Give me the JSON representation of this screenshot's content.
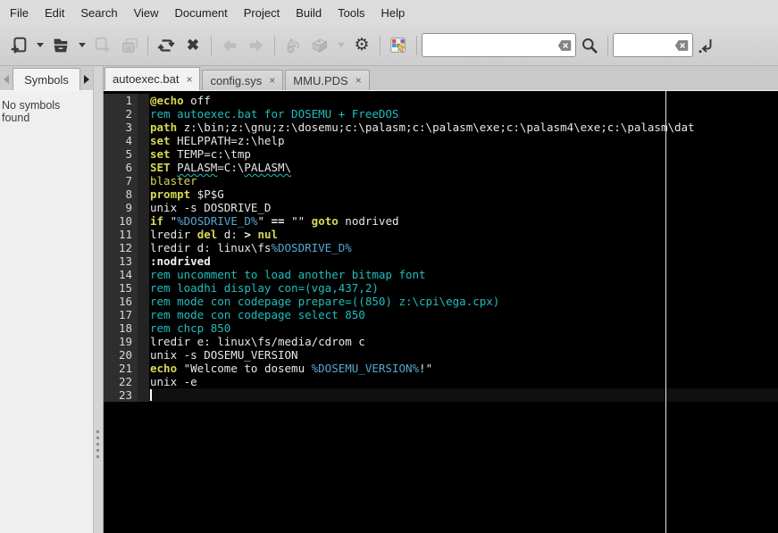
{
  "menubar": {
    "items": [
      "File",
      "Edit",
      "Search",
      "View",
      "Document",
      "Project",
      "Build",
      "Tools",
      "Help"
    ]
  },
  "toolbar": {
    "buttons": [
      {
        "name": "new",
        "icon": "new-file-icon",
        "enabled": true
      },
      {
        "name": "new-menu",
        "icon": "chevron-down-icon",
        "enabled": true
      },
      {
        "name": "open",
        "icon": "open-folder-icon",
        "enabled": true
      },
      {
        "name": "open-menu",
        "icon": "chevron-down-icon",
        "enabled": true
      },
      {
        "name": "save",
        "icon": "save-icon",
        "enabled": false
      },
      {
        "name": "save-all",
        "icon": "save-all-icon",
        "enabled": false
      },
      {
        "name": "revert",
        "icon": "reload-icon",
        "enabled": true
      },
      {
        "name": "close",
        "icon": "close-icon",
        "enabled": true
      },
      {
        "name": "back",
        "icon": "arrow-left-icon",
        "enabled": false
      },
      {
        "name": "forward",
        "icon": "arrow-right-icon",
        "enabled": false
      },
      {
        "name": "compile",
        "icon": "compile-icon",
        "enabled": false
      },
      {
        "name": "build",
        "icon": "brick-icon",
        "enabled": false
      },
      {
        "name": "build-menu",
        "icon": "chevron-down-icon",
        "enabled": false
      },
      {
        "name": "execute",
        "icon": "gear-icon",
        "enabled": true
      },
      {
        "name": "color-chooser",
        "icon": "color-grid-icon",
        "enabled": true
      },
      {
        "name": "search",
        "icon": "magnifier-icon",
        "enabled": true
      },
      {
        "name": "goto-line",
        "icon": "jump-icon",
        "enabled": true
      }
    ],
    "close_glyph": "✖",
    "search": {
      "value": ""
    },
    "goto": {
      "value": ""
    }
  },
  "sidebar": {
    "tab_label": "Symbols",
    "message": "No symbols found"
  },
  "editor": {
    "tabs": [
      {
        "label": "autoexec.bat",
        "active": true
      },
      {
        "label": "config.sys",
        "active": false
      },
      {
        "label": "MMU.PDS",
        "active": false
      }
    ],
    "close_glyph": "×",
    "caret_line": 23,
    "colors": {
      "background": "#000000",
      "keyword": "#d8d855",
      "comment": "#21bdbd",
      "variable": "#56a7d0",
      "plain": "#e8e8e8",
      "gutter_bg": "#2e2e2e",
      "gutter_text": "#d8d8d8",
      "long_line_marker": "#e2eae2"
    },
    "lines": [
      [
        [
          "k",
          "@echo"
        ],
        [
          "p",
          " off"
        ]
      ],
      [
        [
          "c",
          "rem autoexec.bat for DOSEMU + FreeDOS"
        ]
      ],
      [
        [
          "k",
          "path"
        ],
        [
          "p",
          " z:\\bin;z:\\gnu;z:\\dosemu;c:\\palasm;c:\\palasm\\exe;c:\\palasm4\\exe;c:\\palasm\\dat"
        ]
      ],
      [
        [
          "k",
          "set"
        ],
        [
          "p",
          " HELPPATH=z:\\help"
        ]
      ],
      [
        [
          "k",
          "set"
        ],
        [
          "p",
          " TEMP=c:\\tmp"
        ]
      ],
      [
        [
          "k",
          "SET"
        ],
        [
          "p",
          " "
        ],
        [
          "m",
          "PALASM"
        ],
        [
          "p",
          "=C:\\"
        ],
        [
          "m",
          "PALASM\\"
        ]
      ],
      [
        [
          "y",
          "blaster"
        ]
      ],
      [
        [
          "k",
          "prompt"
        ],
        [
          "p",
          " $P$G"
        ]
      ],
      [
        [
          "p",
          "unix -s DOSDRIVE_D"
        ]
      ],
      [
        [
          "k",
          "if"
        ],
        [
          "p",
          " \""
        ],
        [
          "v",
          "%DOSDRIVE_D%"
        ],
        [
          "p",
          "\" "
        ],
        [
          "o",
          "=="
        ],
        [
          "p",
          " \"\" "
        ],
        [
          "k",
          "goto"
        ],
        [
          "p",
          " nodrived"
        ]
      ],
      [
        [
          "p",
          "lredir "
        ],
        [
          "k",
          "del"
        ],
        [
          "p",
          " d: "
        ],
        [
          "o",
          ">"
        ],
        [
          "p",
          " "
        ],
        [
          "k",
          "nul"
        ]
      ],
      [
        [
          "p",
          "lredir d: linux\\fs"
        ],
        [
          "v",
          "%DOSDRIVE_D%"
        ]
      ],
      [
        [
          "l",
          ":nodrived"
        ]
      ],
      [
        [
          "c",
          "rem uncomment to load another bitmap font"
        ]
      ],
      [
        [
          "c",
          "rem loadhi display con=(vga,437,2)"
        ]
      ],
      [
        [
          "c",
          "rem mode con codepage prepare=((850) z:\\cpi\\ega.cpx)"
        ]
      ],
      [
        [
          "c",
          "rem mode con codepage select 850"
        ]
      ],
      [
        [
          "c",
          "rem chcp 850"
        ]
      ],
      [
        [
          "p",
          "lredir e: linux\\fs/media/cdrom c"
        ]
      ],
      [
        [
          "p",
          "unix -s DOSEMU_VERSION"
        ]
      ],
      [
        [
          "k",
          "echo"
        ],
        [
          "p",
          " \"Welcome to dosemu "
        ],
        [
          "v",
          "%DOSEMU_VERSION%"
        ],
        [
          "p",
          "!\""
        ]
      ],
      [
        [
          "p",
          "unix -e"
        ]
      ],
      []
    ]
  }
}
